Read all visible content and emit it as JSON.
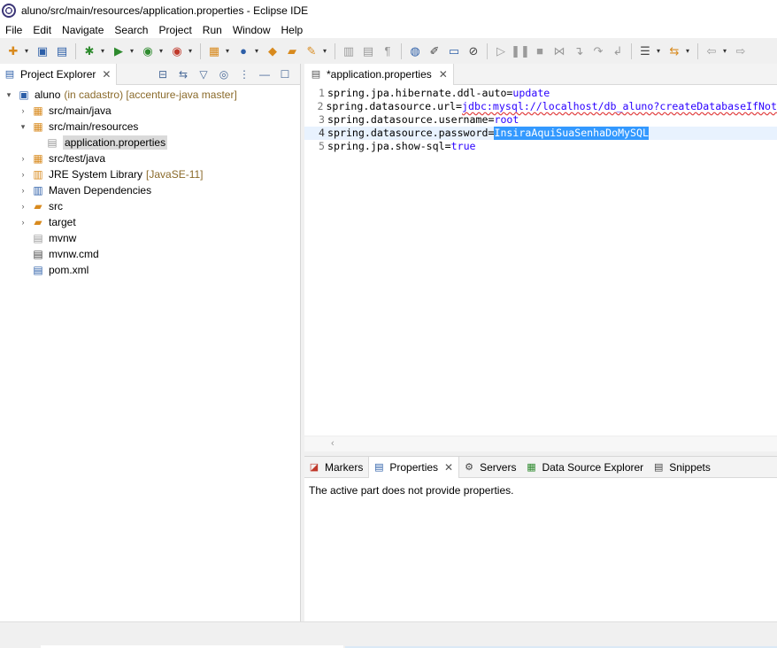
{
  "window": {
    "title": "aluno/src/main/resources/application.properties - Eclipse IDE",
    "app_icon": "eclipse-icon"
  },
  "menu": [
    "File",
    "Edit",
    "Navigate",
    "Search",
    "Project",
    "Run",
    "Window",
    "Help"
  ],
  "toolbar": {
    "buttons": [
      {
        "name": "new-icon",
        "glyph": "✚",
        "color": "c-orange",
        "drop": true
      },
      {
        "name": "save-icon",
        "glyph": "▣",
        "color": "c-blue"
      },
      {
        "name": "save-all-icon",
        "glyph": "▤",
        "color": "c-blue"
      },
      {
        "name": "debug-icon",
        "glyph": "✱",
        "color": "c-green",
        "drop": true
      },
      {
        "name": "run-icon",
        "glyph": "▶",
        "color": "c-green",
        "drop": true
      },
      {
        "name": "coverage-icon",
        "glyph": "◉",
        "color": "c-green",
        "drop": true
      },
      {
        "name": "external-tools-icon",
        "glyph": "◉",
        "color": "c-red",
        "drop": true
      },
      {
        "name": "new-server-icon",
        "glyph": "▦",
        "color": "c-orange",
        "drop": true
      },
      {
        "name": "new-class-icon",
        "glyph": "●",
        "color": "c-blue",
        "drop": true
      },
      {
        "name": "open-type-icon",
        "glyph": "◆",
        "color": "c-orange"
      },
      {
        "name": "open-folder-icon",
        "glyph": "▰",
        "color": "c-orange"
      },
      {
        "name": "search-task-icon",
        "glyph": "✎",
        "color": "c-orange",
        "drop": true
      },
      {
        "name": "toggle-breadcrumb-icon",
        "glyph": "▥",
        "color": "c-gray"
      },
      {
        "name": "toggle-markoccurrences-icon",
        "glyph": "▤",
        "color": "c-gray"
      },
      {
        "name": "show-whitespace-icon",
        "glyph": "¶",
        "color": "c-gray"
      },
      {
        "name": "globe-icon",
        "glyph": "◍",
        "color": "c-blue"
      },
      {
        "name": "pin-icon",
        "glyph": "✐",
        "color": "c-dark"
      },
      {
        "name": "console-icon",
        "glyph": "▭",
        "color": "c-blue"
      },
      {
        "name": "skip-breakpoints-icon",
        "glyph": "⊘",
        "color": "c-dark"
      },
      {
        "name": "resume-icon",
        "glyph": "▷",
        "color": "c-gray"
      },
      {
        "name": "suspend-icon",
        "glyph": "❚❚",
        "color": "c-gray"
      },
      {
        "name": "terminate-icon",
        "glyph": "■",
        "color": "c-gray"
      },
      {
        "name": "disconnect-icon",
        "glyph": "⋈",
        "color": "c-gray"
      },
      {
        "name": "step-into-icon",
        "glyph": "↴",
        "color": "c-gray"
      },
      {
        "name": "step-over-icon",
        "glyph": "↷",
        "color": "c-gray"
      },
      {
        "name": "step-return-icon",
        "glyph": "↲",
        "color": "c-gray"
      },
      {
        "name": "next-annotation-icon",
        "glyph": "☰",
        "color": "c-dark",
        "drop": true
      },
      {
        "name": "prev-annotation-icon",
        "glyph": "⇆",
        "color": "c-orange",
        "drop": true
      },
      {
        "name": "back-icon",
        "glyph": "⇦",
        "color": "c-gray",
        "drop": true
      },
      {
        "name": "forward-icon",
        "glyph": "⇨",
        "color": "c-gray"
      }
    ]
  },
  "project_explorer": {
    "tab_label": "Project Explorer",
    "tree": [
      {
        "level": 0,
        "twisty": "▾",
        "icon": "maven-project-icon",
        "glyph": "▣",
        "color": "c-blue",
        "label": "aluno",
        "decoration": "(in cadastro) [accenture-java master]"
      },
      {
        "level": 1,
        "twisty": "›",
        "icon": "source-folder-icon",
        "glyph": "▦",
        "color": "c-orange",
        "label": "src/main/java",
        "decoration": ""
      },
      {
        "level": 1,
        "twisty": "▾",
        "icon": "source-folder-icon",
        "glyph": "▦",
        "color": "c-orange",
        "label": "src/main/resources",
        "decoration": ""
      },
      {
        "level": 2,
        "twisty": "",
        "icon": "properties-file-icon",
        "glyph": "▤",
        "color": "c-gray",
        "label": "application.properties",
        "decoration": "",
        "selected": true
      },
      {
        "level": 1,
        "twisty": "›",
        "icon": "source-folder-icon",
        "glyph": "▦",
        "color": "c-orange",
        "label": "src/test/java",
        "decoration": ""
      },
      {
        "level": 1,
        "twisty": "›",
        "icon": "library-icon",
        "glyph": "▥",
        "color": "c-orange",
        "label": "JRE System Library",
        "decoration": "[JavaSE-11]"
      },
      {
        "level": 1,
        "twisty": "›",
        "icon": "library-icon",
        "glyph": "▥",
        "color": "c-blue",
        "label": "Maven Dependencies",
        "decoration": ""
      },
      {
        "level": 1,
        "twisty": "›",
        "icon": "folder-icon",
        "glyph": "▰",
        "color": "c-orange",
        "label": "src",
        "decoration": ""
      },
      {
        "level": 1,
        "twisty": "›",
        "icon": "folder-icon",
        "glyph": "▰",
        "color": "c-orange",
        "label": "target",
        "decoration": ""
      },
      {
        "level": 1,
        "twisty": "",
        "icon": "file-icon",
        "glyph": "▤",
        "color": "c-gray",
        "label": "mvnw",
        "decoration": ""
      },
      {
        "level": 1,
        "twisty": "",
        "icon": "script-file-icon",
        "glyph": "▤",
        "color": "c-dark",
        "label": "mvnw.cmd",
        "decoration": ""
      },
      {
        "level": 1,
        "twisty": "",
        "icon": "xml-file-icon",
        "glyph": "▤",
        "color": "c-blue",
        "label": "pom.xml",
        "decoration": ""
      }
    ]
  },
  "editor": {
    "tab_label": "*application.properties",
    "lines": [
      {
        "n": "1",
        "key": "spring.jpa.hibernate.ddl-auto=",
        "value": "update"
      },
      {
        "n": "2",
        "key": "spring.datasource.url=",
        "value": "jdbc:mysql://localhost/db_aluno?createDatabaseIfNot"
      },
      {
        "n": "3",
        "key": "spring.datasource.username=",
        "value": "root"
      },
      {
        "n": "4",
        "key": "spring.datasource.password=",
        "value": "InsiraAquiSuaSenhaDoMySQL",
        "selected": true,
        "current": true
      },
      {
        "n": "5",
        "key": "spring.jpa.show-sql=",
        "value": "true"
      }
    ]
  },
  "bottom_panel": {
    "tabs": [
      {
        "name": "tab-markers",
        "icon": "markers-icon",
        "glyph": "◪",
        "color": "c-red",
        "label": "Markers"
      },
      {
        "name": "tab-properties",
        "icon": "properties-icon",
        "glyph": "▤",
        "color": "c-blue",
        "label": "Properties",
        "active": true
      },
      {
        "name": "tab-servers",
        "icon": "servers-icon",
        "glyph": "⚙",
        "color": "c-dark",
        "label": "Servers"
      },
      {
        "name": "tab-data-source-explorer",
        "icon": "data-source-icon",
        "glyph": "▦",
        "color": "c-green",
        "label": "Data Source Explorer"
      },
      {
        "name": "tab-snippets",
        "icon": "snippets-icon",
        "glyph": "▤",
        "color": "c-dark",
        "label": "Snippets"
      }
    ],
    "message": "The active part does not provide properties."
  }
}
